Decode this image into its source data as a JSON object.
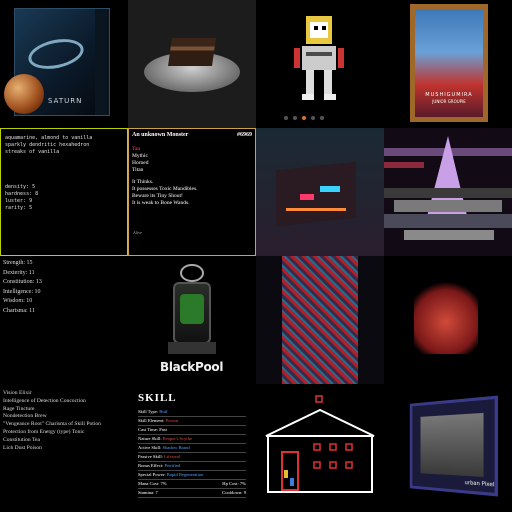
{
  "tiles": {
    "saturn": {
      "label": "SATURN"
    },
    "poster": {
      "caption": "MUSHIGUMIRA",
      "subcaption": "JUNIOR GROUPIE"
    },
    "text_card": {
      "lines": [
        "aquamarine, almond to vanilla",
        "sparkly dendritic hexahedron",
        "streaks of vanilla",
        "",
        "",
        "",
        "",
        "density: 5",
        "hardness: 8",
        "luster: 9",
        "rarity: 5"
      ]
    },
    "monster_card": {
      "title": "An unknown Monster",
      "id": "#6969",
      "traits": [
        "Tan",
        "Mythic",
        "Horned",
        "Titan"
      ],
      "description": [
        "It Thinks.",
        "It possesses Toxic Mandibles.",
        "Beware its Tiny Shout!",
        "It is weak to Bone Wands."
      ],
      "footer": "Alive"
    },
    "stats": {
      "lines": [
        "Strength: 15",
        "Dexterity: 11",
        "Constitution: 13",
        "Intelligence: 10",
        "Wisdom: 10",
        "Charisma: 11"
      ]
    },
    "blackpool": {
      "brand": "BlackPool"
    },
    "potions": {
      "lines": [
        "Vision Elixir",
        "Intelligence of Detection Concoction",
        "Rage Tincture",
        "Nondetection Brew",
        "\"Vengeance Root\" Charisma of Skill Potion",
        "Protection from Energy (type) Tonic",
        "Constitution Tea",
        "Lich Dust Poison"
      ]
    },
    "skill": {
      "heading": "SKILL",
      "rows": [
        {
          "label": "Skill Type:",
          "value": "Buff",
          "color": "blue"
        },
        {
          "label": "Skill Element:",
          "value": "Poison",
          "color": "red"
        },
        {
          "label": "Cast Time:",
          "value": "Fast",
          "color": "none"
        },
        {
          "label": "Nature Skill:",
          "value": "Reaper's Scythe",
          "color": "red"
        },
        {
          "label": "Active Skill:",
          "value": "Shadow Brand",
          "color": "blue"
        },
        {
          "label": "Passive Skill:",
          "value": "Lifesteal",
          "color": "red"
        },
        {
          "label": "Bonus Effect:",
          "value": "Petrified",
          "color": "blue"
        },
        {
          "label": "Special Power:",
          "value": "Rapid Regeneration",
          "color": "blue"
        }
      ],
      "pairs": [
        {
          "a": "Mana Cost: 7%",
          "b": "Hp Cost: 7%"
        },
        {
          "a": "Stamina: 7",
          "b": "Cooldown: 9"
        }
      ]
    },
    "photo": {
      "logo": "urban Pixel"
    }
  },
  "pagination": {
    "count": 5,
    "active": 2
  }
}
